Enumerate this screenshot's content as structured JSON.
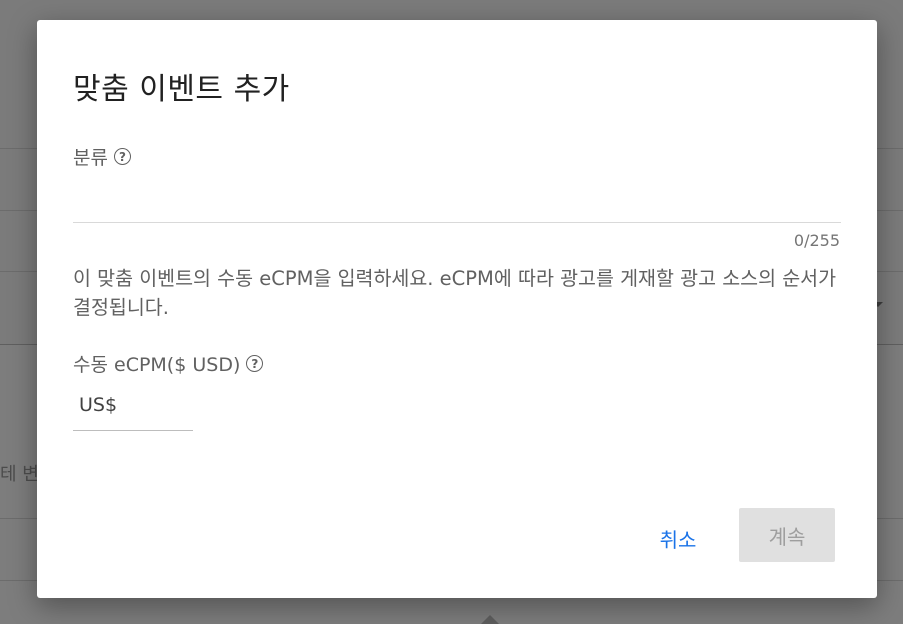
{
  "background": {
    "partial_text": "테 변"
  },
  "dialog": {
    "title": "맞춤 이벤트 추가",
    "category": {
      "label": "분류",
      "value": "",
      "counter": "0/255"
    },
    "description": "이 맞춤 이벤트의 수동 eCPM을 입력하세요. eCPM에 따라 광고를 게재할 광고 소스의 순서가 결정됩니다.",
    "ecpm": {
      "label": "수동 eCPM($ USD)",
      "prefix": "US$",
      "value": ""
    },
    "buttons": {
      "cancel": "취소",
      "continue": "계속"
    }
  },
  "colors": {
    "accent": "#1a73e8",
    "disabled_button_bg": "#e0e0e0",
    "disabled_button_text": "#9e9e9e",
    "scrim": "#7b7b7b"
  },
  "icons": {
    "help": "help-circle-icon"
  }
}
